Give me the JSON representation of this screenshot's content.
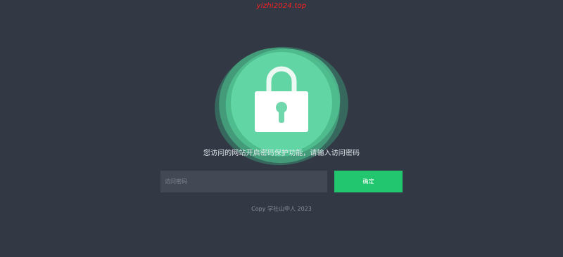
{
  "watermark": {
    "text": "yizhi2024.top",
    "color": "#ff2020"
  },
  "lock": {
    "icon": "padlock-icon",
    "accent": "#5cd5a3"
  },
  "prompt": {
    "text": "您访问的网站开启密码保护功能，请输入访问密码"
  },
  "password": {
    "value": "",
    "placeholder": "访问密码"
  },
  "confirm": {
    "label": "确定",
    "color": "#22c66e"
  },
  "footer": {
    "text": "Copy 学社山中人 2023"
  },
  "colors": {
    "background": "#323945",
    "input_background": "#424955"
  }
}
